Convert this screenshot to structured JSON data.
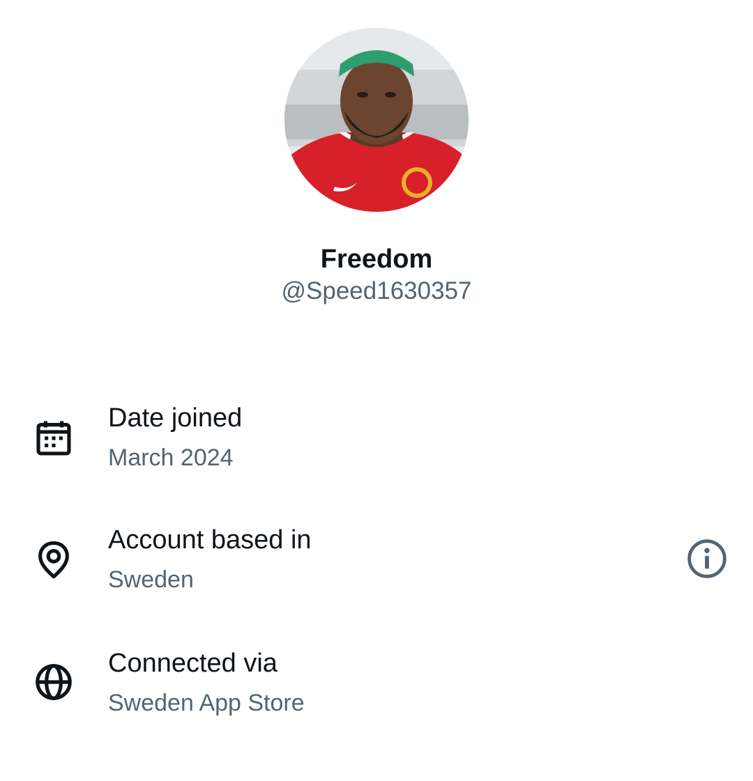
{
  "profile": {
    "display_name": "Freedom",
    "handle": "@Speed1630357",
    "avatar_icon": "profile-photo"
  },
  "details": [
    {
      "title": "Date joined",
      "value": "March 2024",
      "icon": "calendar-icon"
    },
    {
      "title": "Account based in",
      "value": "Sweden",
      "icon": "location-pin-icon",
      "action_icon": "info-icon"
    },
    {
      "title": "Connected via",
      "value": "Sweden App Store",
      "icon": "globe-icon"
    }
  ],
  "colors": {
    "primary_text": "#0f1419",
    "secondary_text": "#536471",
    "background": "#ffffff"
  }
}
